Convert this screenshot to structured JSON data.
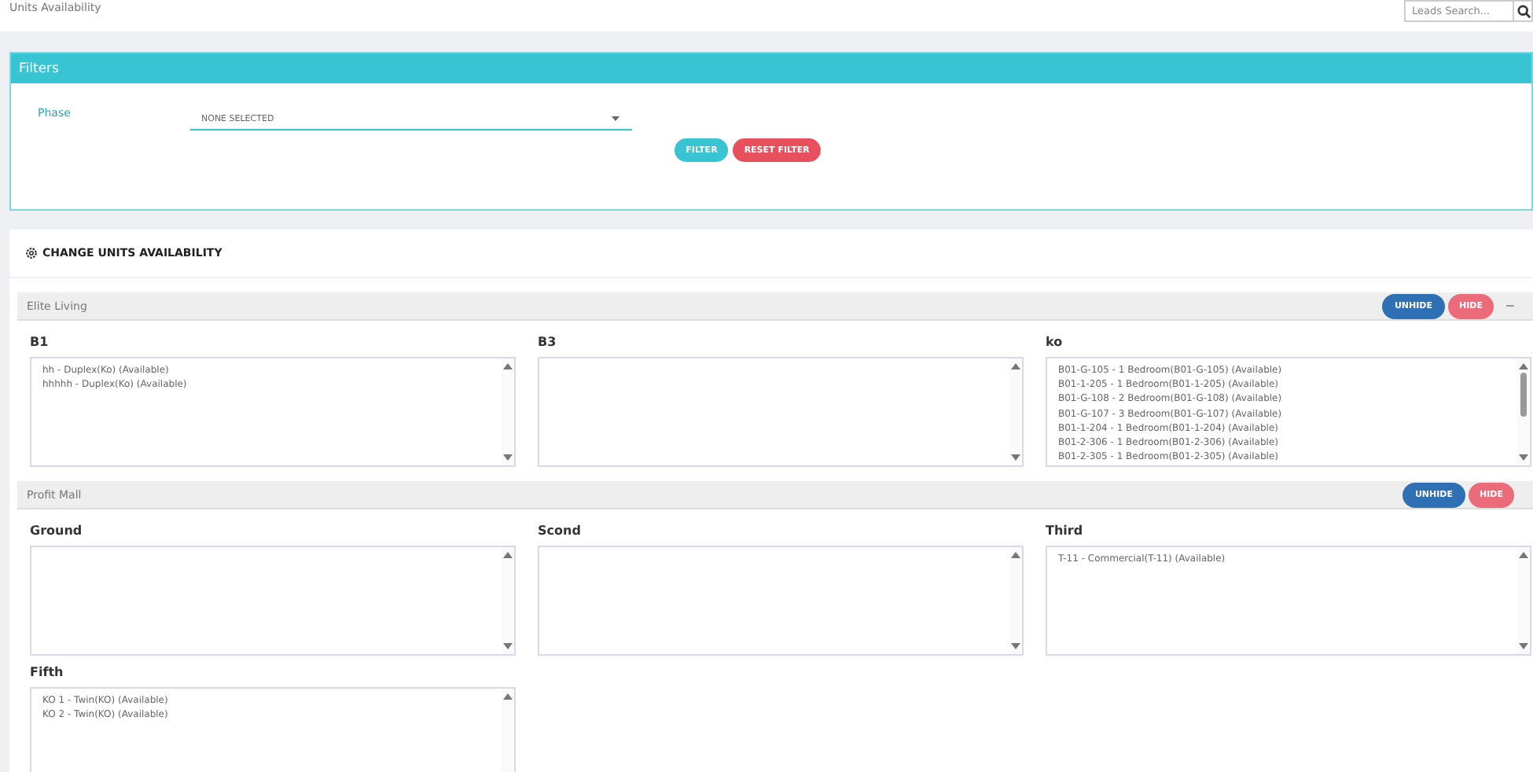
{
  "page_title": "Units Availability",
  "search": {
    "placeholder": "Leads Search..."
  },
  "filters": {
    "title": "Filters",
    "phase_label": "Phase",
    "phase_value": "NONE SELECTED",
    "buttons": [
      {
        "label": "FILTER",
        "kind": "primary"
      },
      {
        "label": "RESET FILTER",
        "kind": "danger"
      }
    ]
  },
  "section_title": "CHANGE UNITS AVAILABILITY",
  "groups": [
    {
      "name": "Elite Living",
      "buttons": [
        {
          "label": "UNHIDE",
          "kind": "unhide"
        },
        {
          "label": "HIDE",
          "kind": "hide"
        }
      ],
      "collapse": true,
      "lists": [
        {
          "title": "B1",
          "scrollable": false,
          "items": [
            "hh - Duplex(Ko) (Available)",
            "hhhhh - Duplex(Ko) (Available)"
          ]
        },
        {
          "title": "B3",
          "scrollable": false
        },
        {
          "title": "ko",
          "scrollable": true,
          "items": [
            "B01-G-105 - 1 Bedroom(B01-G-105) (Available)",
            "B01-1-205 - 1 Bedroom(B01-1-205) (Available)",
            "B01-G-108 - 2 Bedroom(B01-G-108) (Available)",
            "B01-G-107 - 3 Bedroom(B01-G-107) (Available)",
            "B01-1-204 - 1 Bedroom(B01-1-204) (Available)",
            "B01-2-306 - 1 Bedroom(B01-2-306) (Available)",
            "B01-2-305 - 1 Bedroom(B01-2-305) (Available)"
          ]
        }
      ]
    },
    {
      "name": "Profit Mall",
      "buttons": [
        {
          "label": "UNHIDE",
          "kind": "unhide"
        },
        {
          "label": "HIDE",
          "kind": "hide"
        }
      ],
      "collapse": false,
      "lists": [
        {
          "title": "Ground",
          "scrollable": false
        },
        {
          "title": "Scond",
          "scrollable": false
        },
        {
          "title": "Third",
          "scrollable": false,
          "items": [
            "T-11 - Commercial(T-11) (Available)"
          ]
        },
        {
          "title": "Fifth",
          "scrollable": false,
          "items": [
            "KO 1 - Twin(KO) (Available)",
            "KO 2 - Twin(KO) (Available)"
          ]
        }
      ]
    }
  ]
}
